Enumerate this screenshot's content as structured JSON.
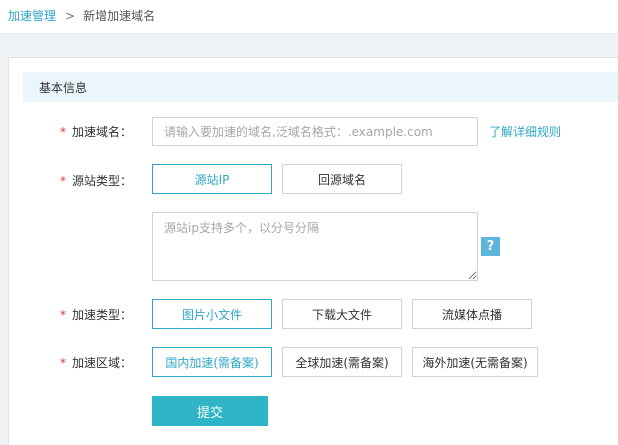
{
  "breadcrumb": {
    "parent": "加速管理",
    "separator": ">",
    "current": "新增加速域名"
  },
  "section_title": "基本信息",
  "required_mark": "*",
  "domain": {
    "label": "加速域名：",
    "value": "",
    "placeholder": "请输入要加速的域名,泛域名格式：.example.com",
    "help_link": "了解详细规则"
  },
  "origin_type": {
    "label": "源站类型：",
    "options": [
      "源站IP",
      "回源域名"
    ],
    "selected": "源站IP",
    "textarea_placeholder": "源站ip支持多个，以分号分隔",
    "textarea_value": "",
    "help_icon": "question-icon",
    "help_glyph": "?"
  },
  "accel_type": {
    "label": "加速类型：",
    "options": [
      "图片小文件",
      "下载大文件",
      "流媒体点播"
    ],
    "selected": "图片小文件"
  },
  "accel_region": {
    "label": "加速区域：",
    "options": [
      "国内加速(需备案)",
      "全球加速(需备案)",
      "海外加速(无需备案)"
    ],
    "selected": "国内加速(需备案)"
  },
  "submit_label": "提交",
  "colors": {
    "accent": "#2fa7c8",
    "submit": "#2fb5c8",
    "header_bg": "#eaf5fc",
    "required": "#e03636"
  }
}
